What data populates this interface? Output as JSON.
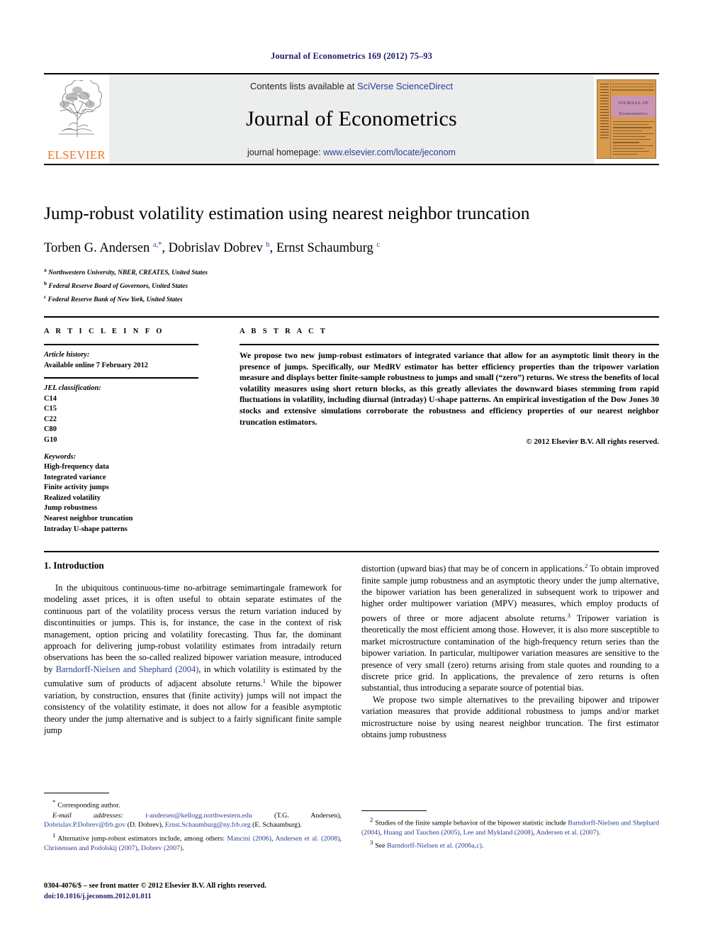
{
  "running_head": "Journal of Econometrics 169 (2012) 75–93",
  "masthead": {
    "publisher": "ELSEVIER",
    "contents_prefix": "Contents lists available at ",
    "sciencedirect": "SciVerse ScienceDirect",
    "journal_title": "Journal of Econometrics",
    "homepage_prefix": "journal homepage: ",
    "homepage_url": "www.elsevier.com/locate/jeconom",
    "cover_title_line1": "JOURNAL OF",
    "cover_title_line2": "Econometrics",
    "accent_orange": "#e87722",
    "link_blue": "#2b3f93",
    "banner_gray": "#eceded",
    "cover_tan": "#d99a4e",
    "cover_band_pink": "#c995b6"
  },
  "article": {
    "title": "Jump-robust volatility estimation using nearest neighbor truncation",
    "authors_html": "Torben G. Andersen <sup>a,*</sup>, Dobrislav Dobrev <sup>b</sup>, Ernst Schaumburg <sup>c</sup>",
    "affiliations": [
      {
        "mark": "a",
        "text": "Northwestern University, NBER, CREATES, United States"
      },
      {
        "mark": "b",
        "text": "Federal Reserve Board of Governors, United States"
      },
      {
        "mark": "c",
        "text": "Federal Reserve Bank of New York, United States"
      }
    ]
  },
  "article_info": {
    "heading": "A R T I C L E    I N F O",
    "history_label": "Article history:",
    "history_value": "Available online 7 February 2012",
    "jel_label": "JEL classification:",
    "jel_codes": [
      "C14",
      "C15",
      "C22",
      "C80",
      "G10"
    ],
    "keywords_label": "Keywords:",
    "keywords": [
      "High-frequency data",
      "Integrated variance",
      "Finite activity jumps",
      "Realized volatility",
      "Jump robustness",
      "Nearest neighbor truncation",
      "Intraday U-shape patterns"
    ]
  },
  "abstract": {
    "heading": "A B S T R A C T",
    "text": "We propose two new jump-robust estimators of integrated variance that allow for an asymptotic limit theory in the presence of jumps. Specifically, our MedRV estimator has better efficiency properties than the tripower variation measure and displays better finite-sample robustness to jumps and small (“zero”) returns. We stress the benefits of local volatility measures using short return blocks, as this greatly alleviates the downward biases stemming from rapid fluctuations in volatility, including diurnal (intraday) U-shape patterns. An empirical investigation of the Dow Jones 30 stocks and extensive simulations corroborate the robustness and efficiency properties of our nearest neighbor truncation estimators.",
    "copyright": "© 2012 Elsevier B.V. All rights reserved."
  },
  "body": {
    "section_title": "1. Introduction",
    "left_para_1_html": "In the ubiquitous continuous-time no-arbitrage semimartingale framework for modeling asset prices, it is often useful to obtain separate estimates of the continuous part of the volatility process versus the return variation induced by discontinuities or jumps. This is, for instance, the case in the context of risk management, option pricing and volatility forecasting. Thus far, the dominant approach for delivering jump-robust volatility estimates from intradaily return observations has been the so-called realized bipower variation measure, introduced by <span class=\"ref-link\">Barndorff-Nielsen and Shephard (2004)</span>, in which volatility is estimated by the cumulative sum of products of adjacent absolute returns.<sup>1</sup> While the bipower variation, by construction, ensures that (finite activity) jumps will not impact the consistency of the volatility estimate, it does not allow for a feasible asymptotic theory under the jump alternative and is subject to a fairly significant finite sample jump",
    "right_para_1_html": "distortion (upward bias) that may be of concern in applications.<sup>2</sup> To obtain improved finite sample jump robustness and an asymptotic theory under the jump alternative, the bipower variation has been generalized in subsequent work to tripower and higher order multipower variation (MPV) measures, which employ products of powers of three or more adjacent absolute returns.<sup>3</sup> Tripower variation is theoretically the most efficient among those. However, it is also more susceptible to market microstructure contamination of the high-frequency return series than the bipower variation. In particular, multipower variation measures are sensitive to the presence of very small (zero) returns arising from stale quotes and rounding to a discrete price grid. In applications, the prevalence of zero returns is often substantial, thus introducing a separate source of potential bias.",
    "right_para_2_html": "We propose two simple alternatives to the prevailing bipower and tripower variation measures that provide additional robustness to jumps and/or market microstructure noise by using nearest neighbor truncation. The first estimator obtains jump robustness"
  },
  "footnotes": {
    "corresponding_label": "Corresponding author.",
    "email_label": "E-mail addresses:",
    "email_html": "<span class=\"mail\">t-andersen@kellogg.northwestern.edu</span> (T.G. Andersen), <span class=\"mail\">Dobrislav.P.Dobrev@frb.gov</span> (D. Dobrev), <span class=\"mail\">Ernst.Schaumburg@ny.frb.org</span> (E. Schaumburg).",
    "fn1_html": "Alternative jump-robust estimators include, among others: <span class=\"ref-link\">Mancini (2006)</span>, <span class=\"ref-link\">Andersen et al. (2008)</span>, <span class=\"ref-link\">Christensen and Podolskij (2007)</span>, <span class=\"ref-link\">Dobrev (2007)</span>.",
    "fn2_html": "Studies of the finite sample behavior of the bipower statistic include <span class=\"ref-link\">Barndorff-Nielsen and Shephard (2004)</span>, <span class=\"ref-link\">Huang and Tauchen (2005)</span>, <span class=\"ref-link\">Lee and Mykland (2008)</span>, <span class=\"ref-link\">Andersen et al. (2007)</span>.",
    "fn3_html": "See <span class=\"ref-link\">Barndorff-Nielsen et al. (2006a,c)</span>.",
    "fn1_mark": "1",
    "fn2_mark": "2",
    "fn3_mark": "3",
    "star_mark": "*"
  },
  "imprint": {
    "issn_line": "0304-4076/$ – see front matter © 2012 Elsevier B.V. All rights reserved.",
    "doi_line": "doi:10.1016/j.jeconom.2012.01.011"
  }
}
